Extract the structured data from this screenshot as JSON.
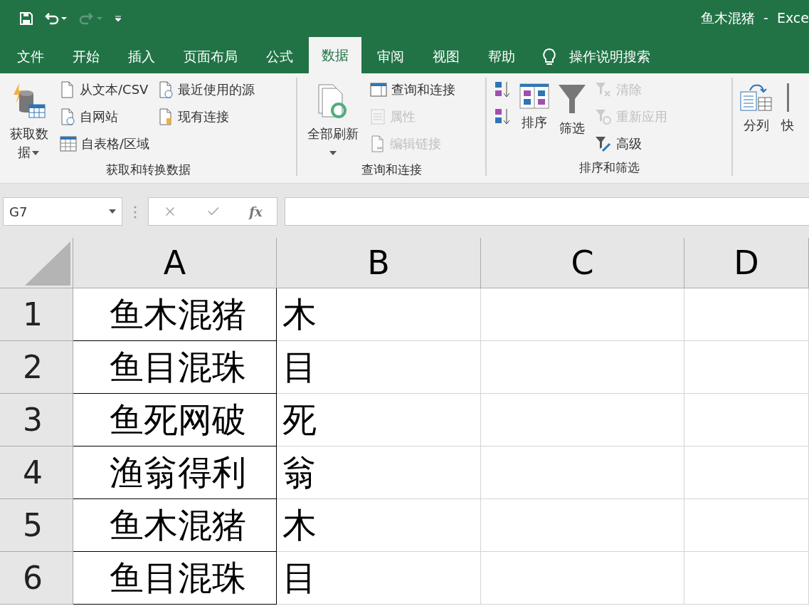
{
  "quick_access": [
    {
      "kind": "save",
      "disabled": false
    },
    {
      "kind": "undo",
      "disabled": false
    },
    {
      "kind": "redo",
      "disabled": true
    },
    {
      "kind": "customize",
      "disabled": false
    }
  ],
  "title": "鱼木混猪  -  Exce",
  "tabs": [
    {
      "label": "文件",
      "selected": false
    },
    {
      "label": "开始",
      "selected": false
    },
    {
      "label": "插入",
      "selected": false
    },
    {
      "label": "页面布局",
      "selected": false
    },
    {
      "label": "公式",
      "selected": false
    },
    {
      "label": "数据",
      "selected": true
    },
    {
      "label": "审阅",
      "selected": false
    },
    {
      "label": "视图",
      "selected": false
    },
    {
      "label": "帮助",
      "selected": false
    }
  ],
  "tell_me": "操作说明搜索",
  "ribbon": {
    "groups": [
      {
        "label": "获取和转换数据",
        "items": [
          {
            "kind": "large",
            "label": "获取数据",
            "dropdown": true,
            "disabled": false
          },
          {
            "kind": "stack",
            "items": [
              {
                "label": "从文本/CSV",
                "disabled": false
              },
              {
                "label": "自网站",
                "disabled": false
              },
              {
                "label": "自表格/区域",
                "disabled": false
              }
            ]
          },
          {
            "kind": "stack",
            "items": [
              {
                "label": "最近使用的源",
                "disabled": false
              },
              {
                "label": "现有连接",
                "disabled": false
              }
            ]
          }
        ]
      },
      {
        "label": "查询和连接",
        "items": [
          {
            "kind": "large",
            "label": "全部刷新",
            "dropdown": true,
            "disabled": false
          },
          {
            "kind": "stack",
            "items": [
              {
                "label": "查询和连接",
                "disabled": false
              },
              {
                "label": "属性",
                "disabled": true
              },
              {
                "label": "编辑链接",
                "disabled": true
              }
            ]
          }
        ]
      },
      {
        "label": "排序和筛选",
        "items": [
          {
            "kind": "stack",
            "items": [
              {
                "disabled": false
              },
              {
                "disabled": false
              }
            ]
          },
          {
            "kind": "large",
            "label": "排序",
            "dropdown": false,
            "disabled": false
          },
          {
            "kind": "large",
            "label": "筛选",
            "dropdown": false,
            "disabled": false
          },
          {
            "kind": "stack",
            "items": [
              {
                "label": "清除",
                "disabled": true
              },
              {
                "label": "重新应用",
                "disabled": true
              },
              {
                "label": "高级",
                "disabled": false
              }
            ]
          }
        ]
      },
      {
        "items": [
          {
            "kind": "large",
            "label": "分列",
            "dropdown": false,
            "disabled": false
          },
          {
            "kind": "large",
            "label": "快",
            "dropdown": false,
            "disabled": false
          }
        ]
      }
    ]
  },
  "formula_bar": {
    "name_box": "G7",
    "function_label": "fx"
  },
  "columns": [
    {
      "label": "A"
    },
    {
      "label": "B"
    },
    {
      "label": "C"
    },
    {
      "label": "D"
    }
  ],
  "rows": [
    {
      "number": "1",
      "cells": [
        "鱼木混猪",
        "木"
      ]
    },
    {
      "number": "2",
      "cells": [
        "鱼目混珠",
        "目"
      ]
    },
    {
      "number": "3",
      "cells": [
        "鱼死网破",
        "死"
      ]
    },
    {
      "number": "4",
      "cells": [
        "渔翁得利",
        "翁"
      ]
    },
    {
      "number": "5",
      "cells": [
        "鱼木混猪",
        "木"
      ]
    },
    {
      "number": "6",
      "cells": [
        "鱼目混珠",
        "目"
      ]
    }
  ]
}
